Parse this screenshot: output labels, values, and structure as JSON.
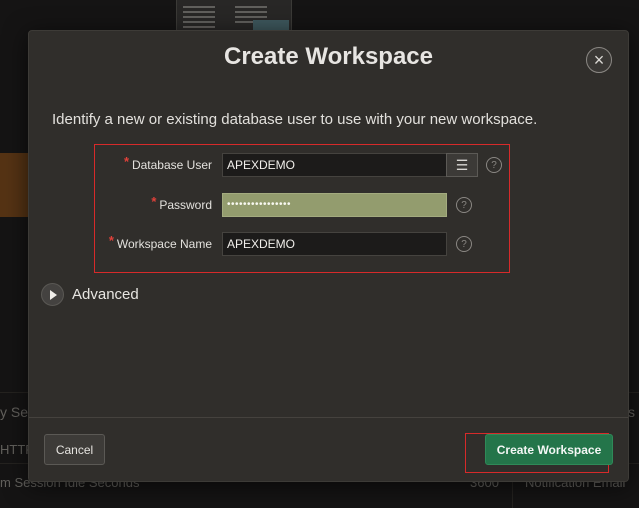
{
  "background": {
    "left_text_1": "y Sessi",
    "left_text_2": "HTTF",
    "left_text_3": "m Session Idle Seconds",
    "value_text": "3600",
    "right_text_1": "s",
    "right_text_2": "Notification Email"
  },
  "modal": {
    "title": "Create Workspace",
    "close_symbol": "×",
    "intro": "Identify a new or existing database user to use with your new workspace.",
    "fields": {
      "database_user": {
        "label": "Database User",
        "value": "APEXDEMO",
        "required_mark": "*"
      },
      "password": {
        "label": "Password",
        "value": "••••••••••••••••",
        "required_mark": "*"
      },
      "workspace_name": {
        "label": "Workspace Name",
        "value": "APEXDEMO",
        "required_mark": "*"
      }
    },
    "help_symbol": "?",
    "lov_symbol": "☰",
    "advanced_label": "Advanced",
    "cancel_label": "Cancel",
    "create_label": "Create Workspace"
  },
  "colors": {
    "primary_button": "#24754a",
    "highlight_outline": "#d72a2a",
    "autofill_bg": "#939c6e"
  }
}
